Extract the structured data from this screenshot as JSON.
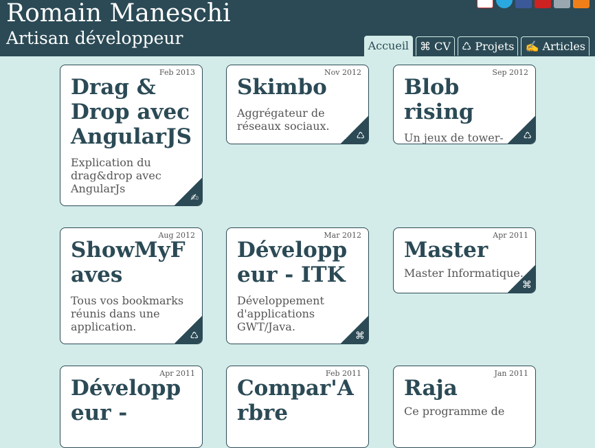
{
  "header": {
    "title": "Romain Maneschi",
    "subtitle": "Artisan développeur",
    "social_icons": [
      "cv-icon",
      "twitter-icon",
      "facebook-icon",
      "scribd-icon",
      "blogger-icon",
      "rss-icon"
    ]
  },
  "nav": {
    "tabs": [
      {
        "label": "Accueil",
        "active": true
      },
      {
        "label": "⌘ CV",
        "active": false
      },
      {
        "label": "♺ Projets",
        "active": false
      },
      {
        "label": "✍ Articles",
        "active": false
      }
    ]
  },
  "cards": [
    {
      "date": "Feb 2013",
      "title": "Drag & Drop avec AngularJS",
      "desc": "Explication du drag&drop avec AngularJs",
      "type": "article",
      "glyph": "✍"
    },
    {
      "date": "Nov 2012",
      "title": "Skimbo",
      "desc": "Aggrégateur de réseaux sociaux.",
      "type": "projet",
      "glyph": "♺"
    },
    {
      "date": "Sep 2012",
      "title": "Blob rising",
      "desc": "Un jeux de tower-défense inversé.",
      "type": "projet",
      "glyph": "♺"
    },
    {
      "date": "Aug 2012",
      "title": "ShowMyFaves",
      "desc": "Tous vos bookmarks réunis dans une application.",
      "type": "projet",
      "glyph": "♺"
    },
    {
      "date": "Mar 2012",
      "title": "Développeur - ITK",
      "desc": "Développement d'applications GWT/Java.",
      "type": "cv",
      "glyph": "⌘"
    },
    {
      "date": "Apr 2011",
      "title": "Master",
      "desc": "Master Informatique.",
      "type": "cv",
      "glyph": "⌘"
    },
    {
      "date": "Apr 2011",
      "title": "Développeur -",
      "desc": "",
      "type": "cv",
      "glyph": "⌘"
    },
    {
      "date": "Feb 2011",
      "title": "Compar'Arbre",
      "desc": "",
      "type": "projet",
      "glyph": "♺"
    },
    {
      "date": "Jan 2011",
      "title": "Raja",
      "desc": "Ce programme de",
      "type": "projet",
      "glyph": "♺"
    }
  ]
}
